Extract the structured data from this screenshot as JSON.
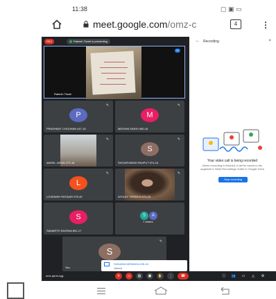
{
  "status_bar": {
    "time": "11:38",
    "right_icons_text": "▢ ▣ ▭"
  },
  "browser": {
    "url_host": "meet.google.com",
    "url_path": "/omz-c",
    "tab_count": "4"
  },
  "meet": {
    "rec_label": "REC",
    "presenting_label": "Rakesh Tiwari is presenting",
    "presenter_name": "Rakesh Tiwari",
    "participant_badge": "23",
    "participants": [
      {
        "name": "PRASHANT CHOUHAN 447-16",
        "initial": "P",
        "color": "#5c6bc0"
      },
      {
        "name": "MEGHNI SINGH 480-16",
        "initial": "M",
        "color": "#e91e63"
      },
      {
        "name": "ANGEL JAYAN 473-16",
        "initial": ""
      },
      {
        "name": "SHOURYANSH RAJPUT 974-16",
        "initial": "S",
        "color": "#8d6e63"
      },
      {
        "name": "LOVENISH PATIDAR 975-20",
        "initial": "L",
        "color": "#f4511e"
      },
      {
        "name": "ATHULY TRIPATHI 976-20",
        "initial": ""
      },
      {
        "name": "SAMARTH SAXENA 891-17",
        "initial": "S",
        "color": "#e91e63"
      },
      {
        "name": "7 others",
        "initial": "S",
        "initial2": "A"
      },
      {
        "name": "You",
        "initial": "S",
        "color": "#8d6e63"
      }
    ],
    "notification": {
      "title": "SUNAINA MEWADA 435-16",
      "subtitle": "Joined"
    },
    "meeting_code": "omz-qeoh-vyg"
  },
  "recording_panel": {
    "title": "Recording",
    "status": "Your video call is being recorded",
    "description": "When recording is finished, it will be saved in the organizer's 'Meet Recordings' folder in Google Drive",
    "stop_button": "Stop recording"
  },
  "colors": {
    "meet_bg": "#202124",
    "tile_bg": "#3c4043",
    "accent": "#1a73e8",
    "rec_red": "#d93025"
  }
}
